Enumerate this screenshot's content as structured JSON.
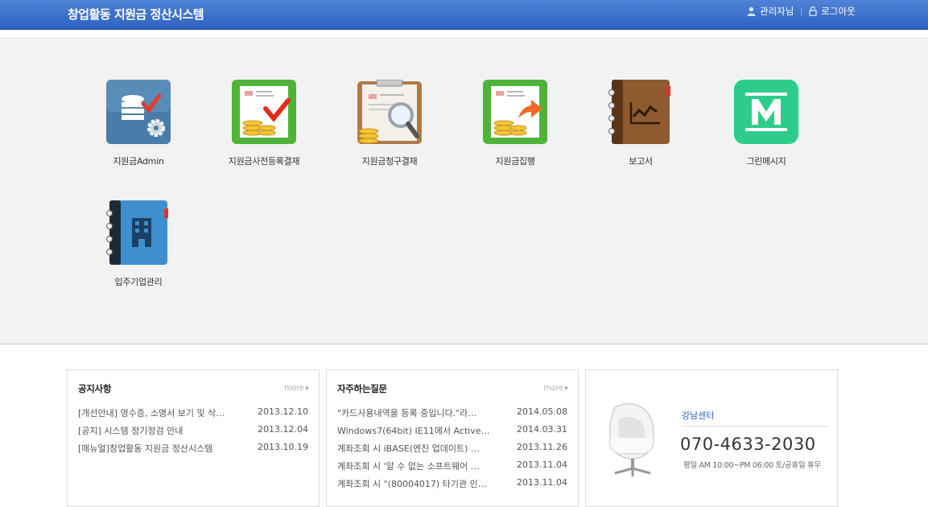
{
  "header": {
    "title": "창업활동 지원금 정산시스템",
    "user_label": "관리자님",
    "logout_label": "로그아웃"
  },
  "apps": [
    {
      "label": "지원금Admin",
      "icon": "database-gear-icon"
    },
    {
      "label": "지원금사전등록결재",
      "icon": "document-coins-check-icon"
    },
    {
      "label": "지원금청구결재",
      "icon": "clipboard-search-icon"
    },
    {
      "label": "지원금집행",
      "icon": "document-coins-arrow-icon"
    },
    {
      "label": "보고서",
      "icon": "report-notebook-icon"
    },
    {
      "label": "그린메시지",
      "icon": "green-message-m-icon"
    },
    {
      "label": "입주기업관리",
      "icon": "building-notebook-icon"
    }
  ],
  "notice": {
    "title": "공지사항",
    "more": "more",
    "items": [
      {
        "text": "[개선안내] 영수증, 소명서 보기 및 삭…",
        "date": "2013.12.10"
      },
      {
        "text": "[공지] 시스템 정기정검 안내",
        "date": "2013.12.04"
      },
      {
        "text": "[매뉴얼]창업활동 지원금 정산시스템",
        "date": "2013.10.19"
      }
    ]
  },
  "faq": {
    "title": "자주하는질문",
    "more": "more",
    "items": [
      {
        "text": "\"카드사용내역을 등록 중입니다.\"라…",
        "date": "2014.05.08"
      },
      {
        "text": "Windows7(64bit) IE11에서 Active…",
        "date": "2014.03.31"
      },
      {
        "text": "계좌조회 시 iBASE(엔진 업데이트) …",
        "date": "2013.11.26"
      },
      {
        "text": "계좌조회 시 '알 수 없는 소프트웨어 …",
        "date": "2013.11.04"
      },
      {
        "text": "계좌조회 시 \"(80004017) 타기관 인…",
        "date": "2013.11.04"
      }
    ]
  },
  "support": {
    "center_name": "강남센터",
    "phone": "070-4633-2030",
    "hours": "평일 AM 10:00~PM 06:00  토/공휴일 휴무",
    "icon": "egg-chair-icon"
  },
  "colors": {
    "header_blue": "#3a6fca",
    "accent_green": "#2ecc8a",
    "link_blue": "#2d63bd"
  }
}
